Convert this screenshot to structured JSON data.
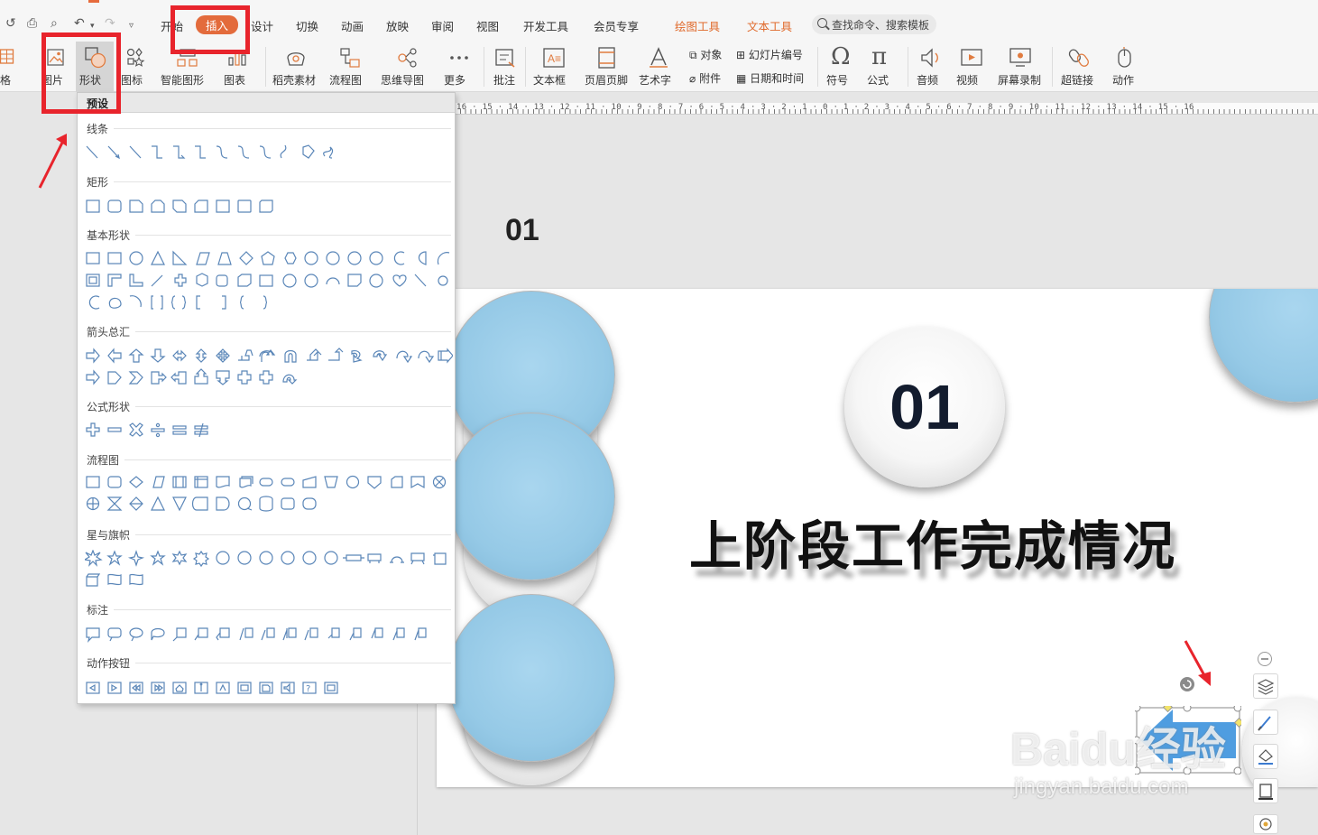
{
  "menubar": {
    "tabs": [
      "开始",
      "插入",
      "设计",
      "切换",
      "动画",
      "放映",
      "审阅",
      "视图",
      "开发工具",
      "会员专享",
      "绘图工具",
      "文本工具"
    ],
    "active_tab": "插入",
    "search_placeholder": "查找命令、搜索模板"
  },
  "toolbar": {
    "table": "格",
    "picture": "图片",
    "shape": "形状",
    "icon": "图标",
    "smart_graphic": "智能图形",
    "chart": "图表",
    "docer": "稻壳素材",
    "flowchart": "流程图",
    "mindmap": "思维导图",
    "more": "更多",
    "comment": "批注",
    "textbox": "文本框",
    "header_footer": "页眉页脚",
    "wordart": "艺术字",
    "object": "对象",
    "attachment": "附件",
    "slide_number": "幻灯片编号",
    "datetime": "日期和时间",
    "symbol": "符号",
    "formula": "公式",
    "audio": "音频",
    "video": "视频",
    "screen_record": "屏幕录制",
    "hyperlink": "超链接",
    "action": "动作"
  },
  "ruler": {
    "labels": "16 · 15 · 14 · 13 · 12 · 11 · 10 · 9 · 8 · 7 · 6 · 5 · 4 · 3 · 2 · 1 · 0 · 1 · 2 · 3 · 4 · 5 · 6 · 7 · 8 · 9 · 10 · 11 · 12 · 13 · 14 · 15 · 16"
  },
  "slide_panel": {
    "slide_number": "01"
  },
  "slide": {
    "number": "01",
    "title": "上阶段工作完成情况"
  },
  "shapes_panel": {
    "header": "预设",
    "sections": {
      "lines": "线条",
      "rectangles": "矩形",
      "basic": "基本形状",
      "arrows": "箭头总汇",
      "equation": "公式形状",
      "flowchart": "流程图",
      "stars": "星与旗帜",
      "callouts": "标注",
      "action_buttons": "动作按钮"
    }
  },
  "watermark": {
    "brand": "Baidu经验",
    "url": "jingyan.baidu.com"
  },
  "colors": {
    "accent": "#e36b3c",
    "annotation": "#e8242c",
    "slide_circle": "#95c9e6",
    "selected_shape": "#4f9de0"
  }
}
